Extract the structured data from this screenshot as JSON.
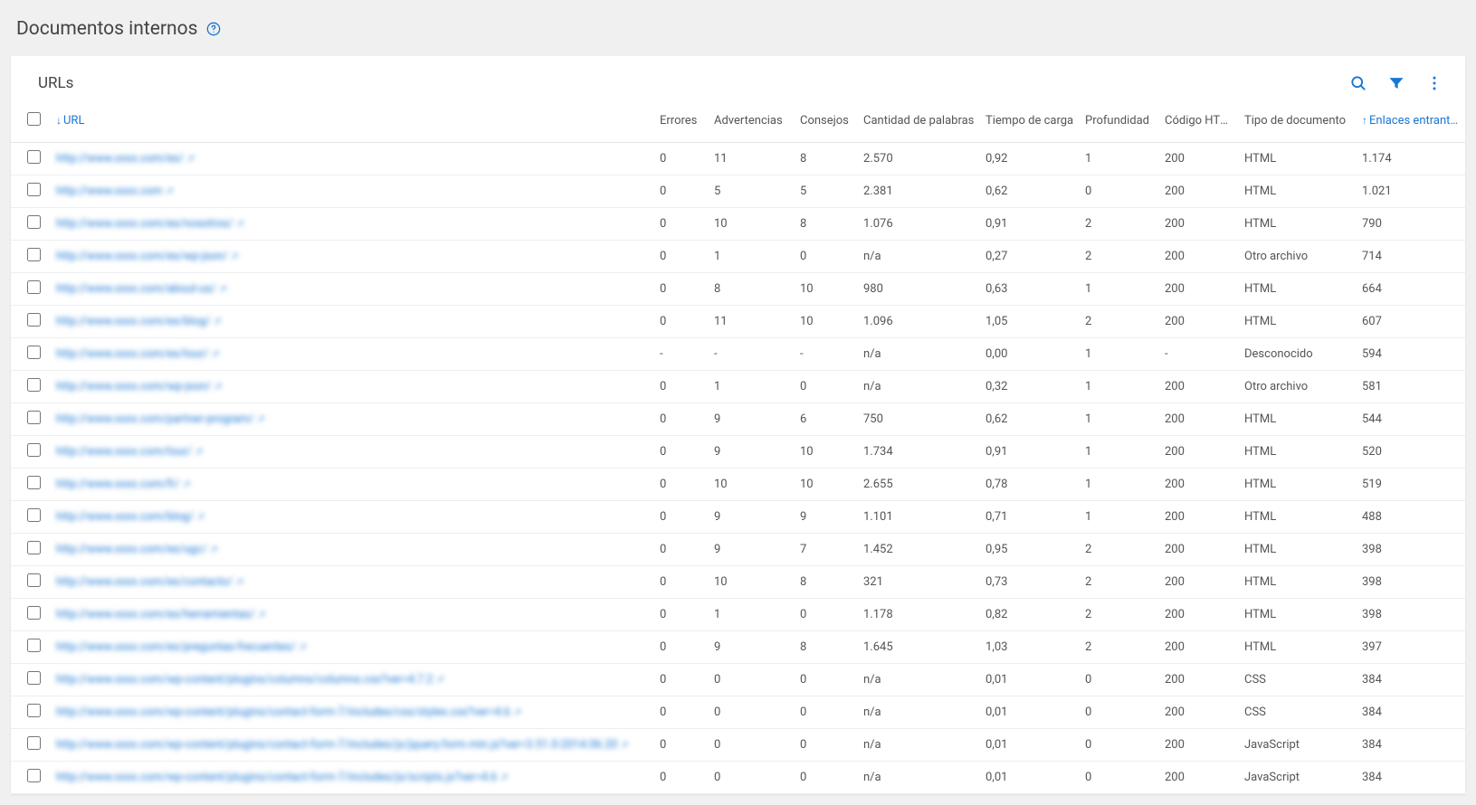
{
  "header": {
    "title": "Documentos internos"
  },
  "card": {
    "title": "URLs"
  },
  "columns": {
    "url": "URL",
    "errors": "Errores",
    "warnings": "Advertencias",
    "advice": "Consejos",
    "words": "Cantidad de palabras",
    "loadtime": "Tiempo de carga",
    "depth": "Profundidad",
    "httpcode": "Código HTTP",
    "doctype": "Tipo de documento",
    "inlinks": "Enlaces entrantes"
  },
  "rows": [
    {
      "url": "http://www.xxxx.com/es/",
      "errors": "0",
      "warnings": "11",
      "advice": "8",
      "words": "2.570",
      "loadtime": "0,92",
      "depth": "1",
      "httpcode": "200",
      "doctype": "HTML",
      "inlinks": "1.174"
    },
    {
      "url": "http://www.xxxx.com",
      "errors": "0",
      "warnings": "5",
      "advice": "5",
      "words": "2.381",
      "loadtime": "0,62",
      "depth": "0",
      "httpcode": "200",
      "doctype": "HTML",
      "inlinks": "1.021"
    },
    {
      "url": "http://www.xxxx.com/es/nosotros/",
      "errors": "0",
      "warnings": "10",
      "advice": "8",
      "words": "1.076",
      "loadtime": "0,91",
      "depth": "2",
      "httpcode": "200",
      "doctype": "HTML",
      "inlinks": "790"
    },
    {
      "url": "http://www.xxxx.com/es/wp-json/",
      "errors": "0",
      "warnings": "1",
      "advice": "0",
      "words": "n/a",
      "loadtime": "0,27",
      "depth": "2",
      "httpcode": "200",
      "doctype": "Otro archivo",
      "inlinks": "714"
    },
    {
      "url": "http://www.xxxx.com/about-us/",
      "errors": "0",
      "warnings": "8",
      "advice": "10",
      "words": "980",
      "loadtime": "0,63",
      "depth": "1",
      "httpcode": "200",
      "doctype": "HTML",
      "inlinks": "664"
    },
    {
      "url": "http://www.xxxx.com/es/blog/",
      "errors": "0",
      "warnings": "11",
      "advice": "10",
      "words": "1.096",
      "loadtime": "1,05",
      "depth": "2",
      "httpcode": "200",
      "doctype": "HTML",
      "inlinks": "607"
    },
    {
      "url": "http://www.xxxx.com/es/tour/",
      "errors": "-",
      "warnings": "-",
      "advice": "-",
      "words": "n/a",
      "loadtime": "0,00",
      "depth": "1",
      "httpcode": "-",
      "doctype": "Desconocido",
      "inlinks": "594"
    },
    {
      "url": "http://www.xxxx.com/wp-json/",
      "errors": "0",
      "warnings": "1",
      "advice": "0",
      "words": "n/a",
      "loadtime": "0,32",
      "depth": "1",
      "httpcode": "200",
      "doctype": "Otro archivo",
      "inlinks": "581"
    },
    {
      "url": "http://www.xxxx.com/partner-program/",
      "errors": "0",
      "warnings": "9",
      "advice": "6",
      "words": "750",
      "loadtime": "0,62",
      "depth": "1",
      "httpcode": "200",
      "doctype": "HTML",
      "inlinks": "544"
    },
    {
      "url": "http://www.xxxx.com/tour/",
      "errors": "0",
      "warnings": "9",
      "advice": "10",
      "words": "1.734",
      "loadtime": "0,91",
      "depth": "1",
      "httpcode": "200",
      "doctype": "HTML",
      "inlinks": "520"
    },
    {
      "url": "http://www.xxxx.com/fr/",
      "errors": "0",
      "warnings": "10",
      "advice": "10",
      "words": "2.655",
      "loadtime": "0,78",
      "depth": "1",
      "httpcode": "200",
      "doctype": "HTML",
      "inlinks": "519"
    },
    {
      "url": "http://www.xxxx.com/blog/",
      "errors": "0",
      "warnings": "9",
      "advice": "9",
      "words": "1.101",
      "loadtime": "0,71",
      "depth": "1",
      "httpcode": "200",
      "doctype": "HTML",
      "inlinks": "488"
    },
    {
      "url": "http://www.xxxx.com/es/ugc/",
      "errors": "0",
      "warnings": "9",
      "advice": "7",
      "words": "1.452",
      "loadtime": "0,95",
      "depth": "2",
      "httpcode": "200",
      "doctype": "HTML",
      "inlinks": "398"
    },
    {
      "url": "http://www.xxxx.com/es/contacto/",
      "errors": "0",
      "warnings": "10",
      "advice": "8",
      "words": "321",
      "loadtime": "0,73",
      "depth": "2",
      "httpcode": "200",
      "doctype": "HTML",
      "inlinks": "398"
    },
    {
      "url": "http://www.xxxx.com/es/herramientas/",
      "errors": "0",
      "warnings": "1",
      "advice": "0",
      "words": "1.178",
      "loadtime": "0,82",
      "depth": "2",
      "httpcode": "200",
      "doctype": "HTML",
      "inlinks": "398"
    },
    {
      "url": "http://www.xxxx.com/es/preguntas-frecuentes/",
      "errors": "0",
      "warnings": "9",
      "advice": "8",
      "words": "1.645",
      "loadtime": "1,03",
      "depth": "2",
      "httpcode": "200",
      "doctype": "HTML",
      "inlinks": "397"
    },
    {
      "url": "http://www.xxxx.com/wp-content/plugins/columns/columns.css?ver=4.7.2",
      "errors": "0",
      "warnings": "0",
      "advice": "0",
      "words": "n/a",
      "loadtime": "0,01",
      "depth": "0",
      "httpcode": "200",
      "doctype": "CSS",
      "inlinks": "384"
    },
    {
      "url": "http://www.xxxx.com/wp-content/plugins/contact-form-7/includes/css/styles.css?ver=4.6",
      "errors": "0",
      "warnings": "0",
      "advice": "0",
      "words": "n/a",
      "loadtime": "0,01",
      "depth": "0",
      "httpcode": "200",
      "doctype": "CSS",
      "inlinks": "384"
    },
    {
      "url": "http://www.xxxx.com/wp-content/plugins/contact-form-7/includes/js/jquery.form.min.js?ver=3.51.0-2014.06.20",
      "errors": "0",
      "warnings": "0",
      "advice": "0",
      "words": "n/a",
      "loadtime": "0,01",
      "depth": "0",
      "httpcode": "200",
      "doctype": "JavaScript",
      "inlinks": "384"
    },
    {
      "url": "http://www.xxxx.com/wp-content/plugins/contact-form-7/includes/js/scripts.js?ver=4.6",
      "errors": "0",
      "warnings": "0",
      "advice": "0",
      "words": "n/a",
      "loadtime": "0,01",
      "depth": "0",
      "httpcode": "200",
      "doctype": "JavaScript",
      "inlinks": "384"
    }
  ]
}
